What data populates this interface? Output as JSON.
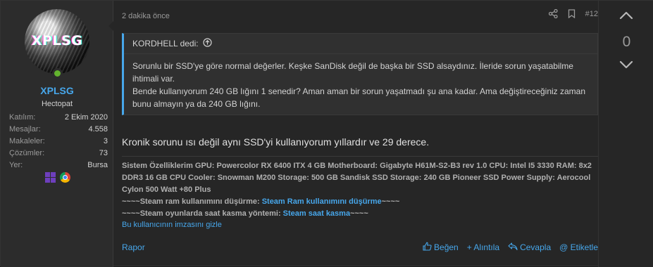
{
  "user": {
    "avatar_text": "XPLSG",
    "name": "XPLSG",
    "title": "Hectopat",
    "stats": [
      {
        "label": "Katılım:",
        "value": "2 Ekim 2020"
      },
      {
        "label": "Mesajlar:",
        "value": "4.558"
      },
      {
        "label": "Makaleler:",
        "value": "3"
      },
      {
        "label": "Çözümler:",
        "value": "73"
      },
      {
        "label": "Yer:",
        "value": "Bursa"
      }
    ],
    "icons": [
      "windows-icon",
      "chrome-icon"
    ]
  },
  "post": {
    "time": "2 dakika önce",
    "number": "#12",
    "quote": {
      "author": "KORDHELL dedi:",
      "line1": "Sorunlu bir SSD'ye göre normal değerler. Keşke SanDisk değil de başka bir SSD alsaydınız. İleride sorun yaşatabilme ihtimali var.",
      "line2": "Bende kullanıyorum 240 GB lığını 1 senedir? Aman aman bir sorun yaşatmadı şu ana kadar. Ama değiştireceğiniz zaman bunu almayın ya da 240 GB lığını."
    },
    "text": "Kronik sorunu ısı değil aynı SSD'yi kullanıyorum yıllardır ve 29 derece.",
    "signature": {
      "specs": "Sistem Özelliklerim GPU: Powercolor RX 6400 ITX 4 GB Motherboard: Gigabyte H61M-S2-B3 rev 1.0 CPU: Intel I5 3330 RAM: 8x2 DDR3 16 GB CPU Cooler: Snowman M200 Storage: 500 GB Sandisk SSD Storage: 240 GB Pioneer SSD Power Supply: Aerocool Cylon 500 Watt +80 Plus",
      "line2_prefix": "~~~~Steam ram kullanımını düşürme: ",
      "line2_link": "Steam Ram kullanımını düşürme",
      "line2_suffix": "~~~~",
      "line3_prefix": "~~~~Steam oyunlarda saat kasma yöntemi: ",
      "line3_link": "Steam saat kasma",
      "line3_suffix": "~~~~",
      "hide_link": "Bu kullanıcının imzasını gizle"
    },
    "footer": {
      "report": "Rapor",
      "like": "Beğen",
      "quote": "+ Alıntıla",
      "reply": "Cevapla",
      "tag": "@ Etiketle"
    }
  },
  "vote": {
    "count": "0"
  },
  "colors": {
    "accent": "#47a7eb",
    "online": "#63b32e",
    "background": "#262626"
  }
}
